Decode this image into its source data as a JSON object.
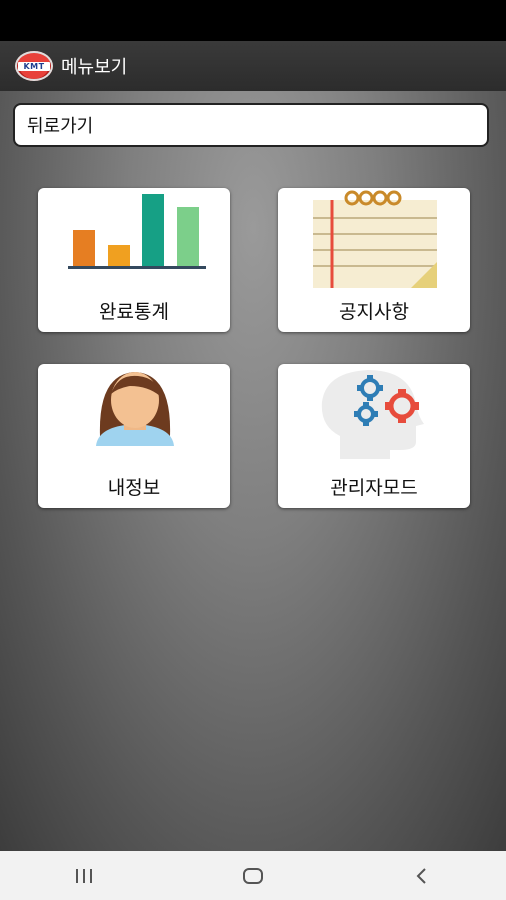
{
  "app_bar": {
    "title": "메뉴보기",
    "logo_text": "KMT"
  },
  "back": {
    "label": "뒤로가기"
  },
  "menu": [
    {
      "label": "완료통계",
      "icon": "bar-chart-icon"
    },
    {
      "label": "공지사항",
      "icon": "notepad-icon"
    },
    {
      "label": "내정보",
      "icon": "user-avatar-icon"
    },
    {
      "label": "관리자모드",
      "icon": "gears-head-icon"
    }
  ],
  "nav": [
    "recent-apps-icon",
    "home-icon",
    "back-icon"
  ],
  "colors": {
    "app_bar": "#2c2c2c",
    "chart_orange": "#e67e22",
    "chart_yellow": "#f0a020",
    "chart_teal": "#16a085",
    "chart_green": "#7ccf8a",
    "gear_blue": "#2e7db5",
    "gear_red": "#e74c3c"
  }
}
